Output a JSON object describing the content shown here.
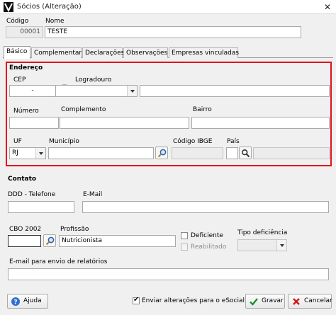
{
  "window": {
    "title": "Sócios (Alteração)",
    "close_glyph": "✕"
  },
  "header": {
    "codigo_label": "Código",
    "codigo_value": "00001",
    "nome_label": "Nome",
    "nome_value": "TESTE"
  },
  "tabs": [
    {
      "label": "Básico",
      "active": true
    },
    {
      "label": "Complementar"
    },
    {
      "label": "Declarações"
    },
    {
      "label": "Observações"
    },
    {
      "label": "Empresas vinculadas"
    }
  ],
  "endereco": {
    "section_title": "Endereço",
    "cep_label": "CEP",
    "cep_value": "-",
    "logradouro_label": "Logradouro",
    "logradouro_type_value": "",
    "logradouro_value": "",
    "numero_label": "Número",
    "complemento_label": "Complemento",
    "bairro_label": "Bairro",
    "uf_label": "UF",
    "uf_value": "RJ",
    "municipio_label": "Município",
    "codigo_ibge_label": "Código IBGE",
    "pais_label": "País"
  },
  "contato": {
    "section_title": "Contato",
    "ddd_label": "DDD - Telefone",
    "email_label": "E-Mail",
    "cbo_label": "CBO 2002",
    "profissao_label": "Profissão",
    "profissao_value": "Nutricionista",
    "deficiente_label": "Deficiente",
    "deficiente_checked": false,
    "reabilitado_label": "Reabilitado",
    "reabilitado_checked": false,
    "tipo_deficiencia_label": "Tipo deficiência",
    "email_relatorios_label": "E-mail para envio de relatórios"
  },
  "footer": {
    "ajuda_label": "Ajuda",
    "esocial_label": "Enviar alterações para o eSocial",
    "esocial_checked": true,
    "gravar_label": "Gravar",
    "cancelar_label": "Cancelar"
  },
  "colors": {
    "highlight_border": "#e0101e",
    "ok_green": "#1f8f2a",
    "cancel_red": "#d01818"
  }
}
